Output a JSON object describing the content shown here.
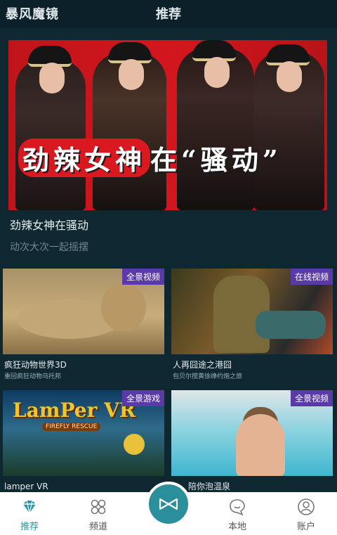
{
  "header": {
    "app_name": "暴风魔镜",
    "page_title": "推荐"
  },
  "hero": {
    "overlay_text_1": "劲辣女神",
    "overlay_text_2": "在“骚动”",
    "title": "劲辣女神在骚动",
    "subtitle": "动次大次一起摇摆",
    "carousel_dots": 2,
    "active_dot": 1
  },
  "cards": [
    {
      "badge": "全景视频",
      "title": "疯狂动物世界3D",
      "subtitle": "重回疯狂动物乌托邦"
    },
    {
      "badge": "在线视频",
      "title": "人再囧途之港囧",
      "subtitle": "包贝尔搅黄徐峥约炮之旅"
    },
    {
      "badge": "全景游戏",
      "title": "lamper VR",
      "subtitle": "",
      "art_title": "LamPer VR",
      "art_subtitle": "FIREFLY RESCUE"
    },
    {
      "badge": "全景视频",
      "title": "陪你泡温泉",
      "subtitle": ""
    }
  ],
  "bottom_nav": {
    "items": [
      {
        "label": "推荐",
        "icon": "diamond-icon",
        "active": true
      },
      {
        "label": "频道",
        "icon": "grid-circles-icon",
        "active": false
      },
      {
        "label": "",
        "icon": "vr-glasses-icon",
        "active": false
      },
      {
        "label": "本地",
        "icon": "chat-bubble-icon",
        "active": false
      },
      {
        "label": "账户",
        "icon": "user-icon",
        "active": false
      }
    ]
  },
  "colors": {
    "background": "#0f2730",
    "accent": "#2a97a3",
    "badge": "#5a3aa8",
    "hero_red": "#c0141b"
  }
}
